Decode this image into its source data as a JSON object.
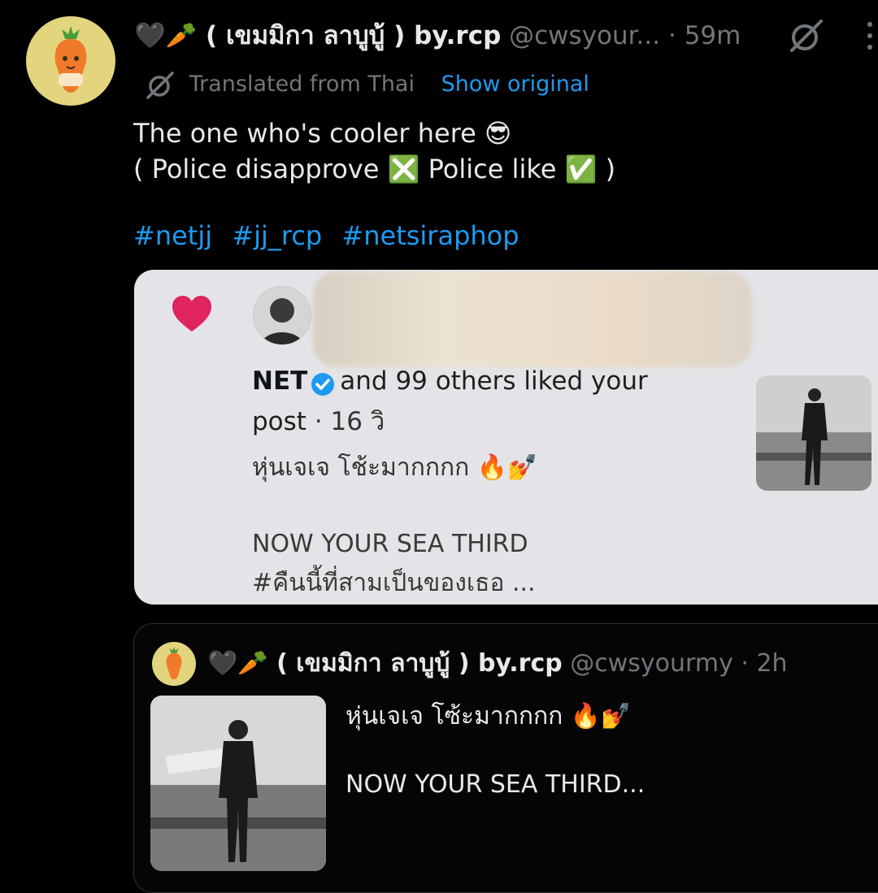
{
  "tweet": {
    "display_name": "🖤🥕 ( เขมมิกา ลาบูบู้ ) by.rcp",
    "handle": "@cwsyour...",
    "time": "· 59m",
    "translated_label": "Translated from Thai",
    "show_original": "Show original",
    "body_line1": "The one who's cooler here 😎",
    "body_line2": "( Police disapprove ❎ Police like ✅ )",
    "hashtags": [
      "#netjj",
      "#jj_rcp",
      "#netsiraphop"
    ]
  },
  "notification": {
    "liker_name": "NET",
    "action_text": "and 99 others liked your post",
    "time": "· 16 วิ",
    "caption": "หุ่นเจเจ โช้ะมากกกก 🔥💅",
    "line1": "NOW YOUR SEA THIRD",
    "line2": "#คืนนี้ที่สามเป็นของเธอ ..."
  },
  "quoted": {
    "display_name": "🖤🥕 ( เขมมิกา ลาบูบู้ ) by.rcp",
    "handle": "@cwsyourmy",
    "time": "· 2h",
    "caption": "หุ่นเจเจ โซ้ะมากกกก 🔥💅",
    "line1": "NOW YOUR SEA THIRD..."
  },
  "icons": {
    "grok": "grok-icon",
    "more": "more-options-icon",
    "translate": "translate-icon",
    "heart": "heart-icon",
    "verified": "verified-badge-icon"
  },
  "colors": {
    "background": "#000000",
    "link": "#1d9bf0",
    "muted": "#71767b",
    "heart": "#e0245e",
    "card": "#e4e4e8",
    "avatar_bg": "#e2d57e"
  }
}
